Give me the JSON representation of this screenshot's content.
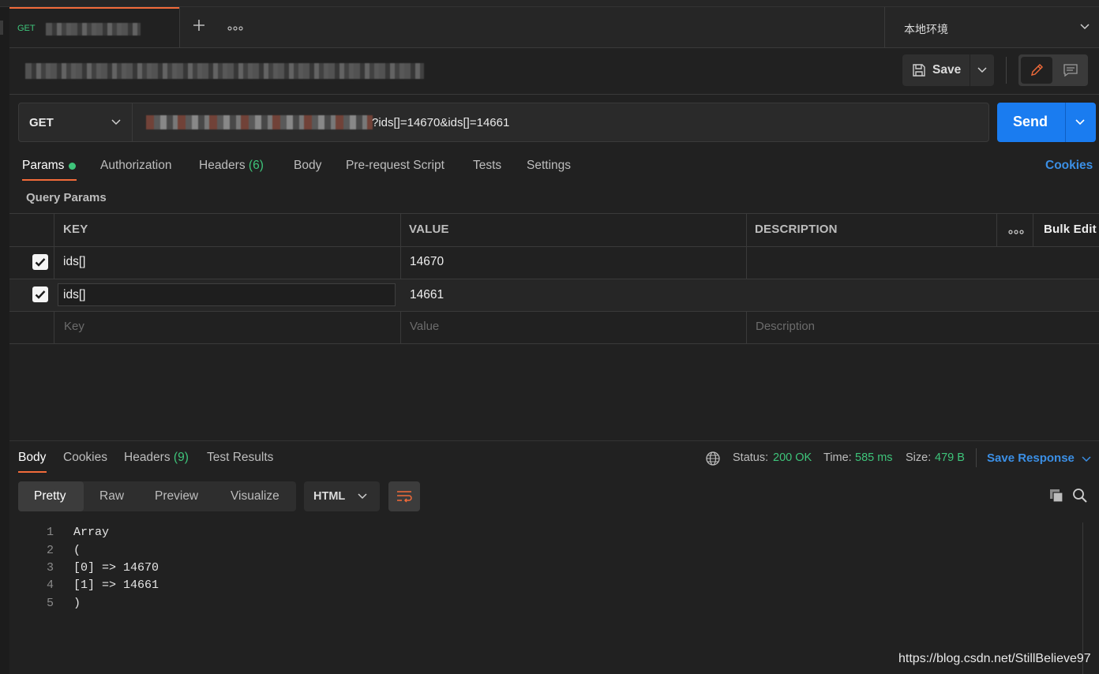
{
  "tabbar": {
    "tab_method": "GET",
    "environment": "本地环境"
  },
  "toolbar": {
    "save_label": "Save"
  },
  "request": {
    "method": "GET",
    "url_visible": "?ids[]=14670&ids[]=14661",
    "send_label": "Send"
  },
  "request_tabs": {
    "params": "Params",
    "authorization": "Authorization",
    "headers": "Headers",
    "headers_count": "(6)",
    "body": "Body",
    "prerequest": "Pre-request Script",
    "tests": "Tests",
    "settings": "Settings",
    "cookies": "Cookies"
  },
  "query_params": {
    "title": "Query Params",
    "columns": {
      "key": "KEY",
      "value": "VALUE",
      "description": "DESCRIPTION"
    },
    "bulk_edit": "Bulk Edit",
    "rows": [
      {
        "key": "ids[]",
        "value": "14670",
        "description": ""
      },
      {
        "key": "ids[]",
        "value": "14661",
        "description": ""
      }
    ],
    "placeholders": {
      "key": "Key",
      "value": "Value",
      "description": "Description"
    }
  },
  "response": {
    "tabs": {
      "body": "Body",
      "cookies": "Cookies",
      "headers": "Headers",
      "headers_count": "(9)",
      "test_results": "Test Results"
    },
    "status_label": "Status:",
    "status_value": "200 OK",
    "time_label": "Time:",
    "time_value": "585 ms",
    "size_label": "Size:",
    "size_value": "479 B",
    "save_response": "Save Response",
    "view_modes": {
      "pretty": "Pretty",
      "raw": "Raw",
      "preview": "Preview",
      "visualize": "Visualize"
    },
    "format": "HTML",
    "lines": [
      {
        "n": "1",
        "text": "Array"
      },
      {
        "n": "2",
        "text": "("
      },
      {
        "n": "3",
        "text": "[0] => 14670"
      },
      {
        "n": "4",
        "text": "[1] => 14661"
      },
      {
        "n": "5",
        "text": ")"
      }
    ]
  },
  "watermark": "https://blog.csdn.net/StillBelieve97",
  "colors": {
    "accent_orange": "#f26b3a",
    "send_blue": "#1a7cf0",
    "link_blue": "#3b8fe5",
    "status_green": "#3ec47a",
    "background": "#212121"
  }
}
